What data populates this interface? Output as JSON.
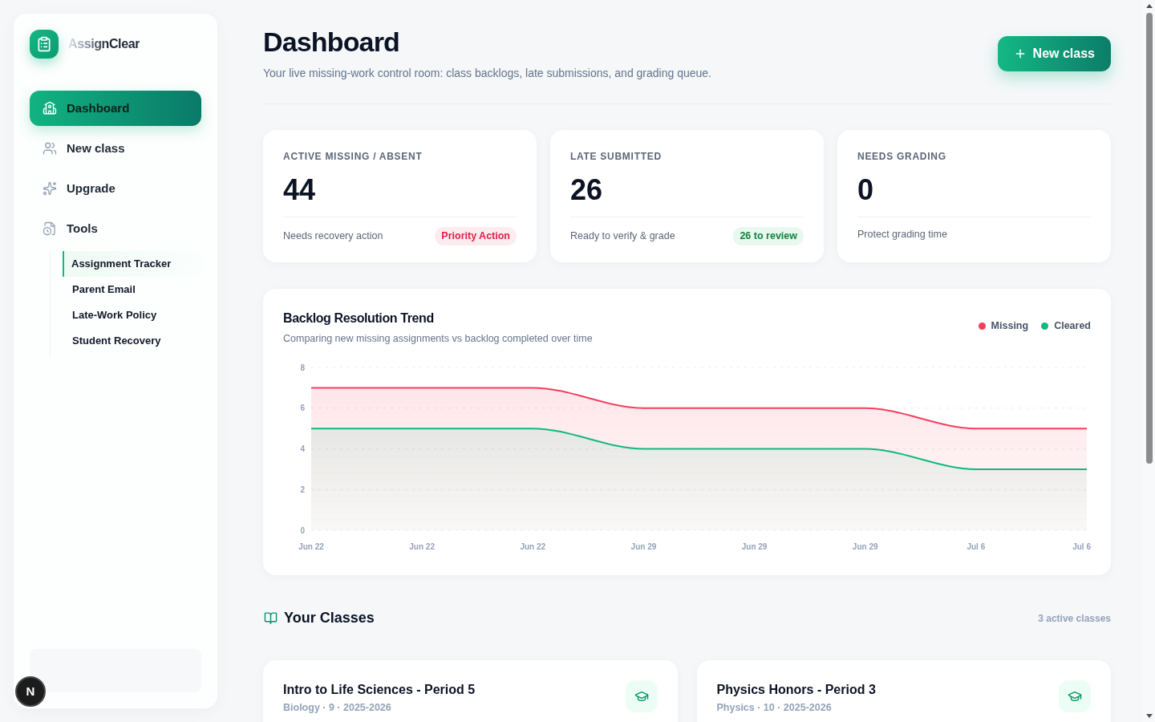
{
  "sidebar": {
    "brand": "AssignClear",
    "nav": [
      {
        "label": "Dashboard",
        "selected": true
      },
      {
        "label": "New class",
        "selected": false
      },
      {
        "label": "Upgrade",
        "selected": false
      },
      {
        "label": "Tools",
        "selected": false,
        "children": [
          {
            "label": "Assignment Tracker",
            "selected": true
          },
          {
            "label": "Parent Email",
            "selected": false
          },
          {
            "label": "Late-Work Policy",
            "selected": false
          },
          {
            "label": "Student Recovery",
            "selected": false
          }
        ]
      }
    ]
  },
  "header": {
    "title": "Dashboard",
    "subtitle": "Your live missing-work control room: class backlogs, late submissions, and grading queue.",
    "action": "New class"
  },
  "stats": [
    {
      "label": "ACTIVE MISSING / ABSENT",
      "value": "44",
      "note": "Needs recovery action",
      "badge": {
        "text": "Priority Action",
        "kind": "danger"
      }
    },
    {
      "label": "LATE SUBMITTED",
      "value": "26",
      "note": "Ready to verify & grade",
      "badge": {
        "text": "26 to review",
        "kind": "success"
      }
    },
    {
      "label": "NEEDS GRADING",
      "value": "0",
      "note": "Protect grading time"
    }
  ],
  "trend": {
    "chart_data": {
      "type": "area",
      "title": "Backlog Resolution Trend",
      "subtitle": "Comparing new missing assignments vs backlog completed over time",
      "categories": [
        "Jun 22",
        "Jun 22",
        "Jun 22",
        "Jun 29",
        "Jun 29",
        "Jun 29",
        "Jul 6",
        "Jul 6"
      ],
      "ylim": [
        0,
        8
      ],
      "yticks": [
        0,
        2,
        4,
        6,
        8
      ],
      "grid": true,
      "legend": "top-right",
      "series": [
        {
          "name": "Missing",
          "color": "#f43f5e",
          "values": [
            7,
            7,
            7,
            6,
            6,
            6,
            5,
            5
          ]
        },
        {
          "name": "Cleared",
          "color": "#10b981",
          "values": [
            5,
            5,
            5,
            4,
            4,
            4,
            3,
            3
          ]
        }
      ]
    }
  },
  "classes": {
    "title": "Your Classes",
    "count": "3 active classes",
    "items": [
      {
        "name": "Intro to Life Sciences - Period 5",
        "meta": "Biology · 9 · 2025-2026"
      },
      {
        "name": "Physics Honors - Period 3",
        "meta": "Physics · 10 · 2025-2026"
      }
    ]
  },
  "dev_indicator": "N"
}
